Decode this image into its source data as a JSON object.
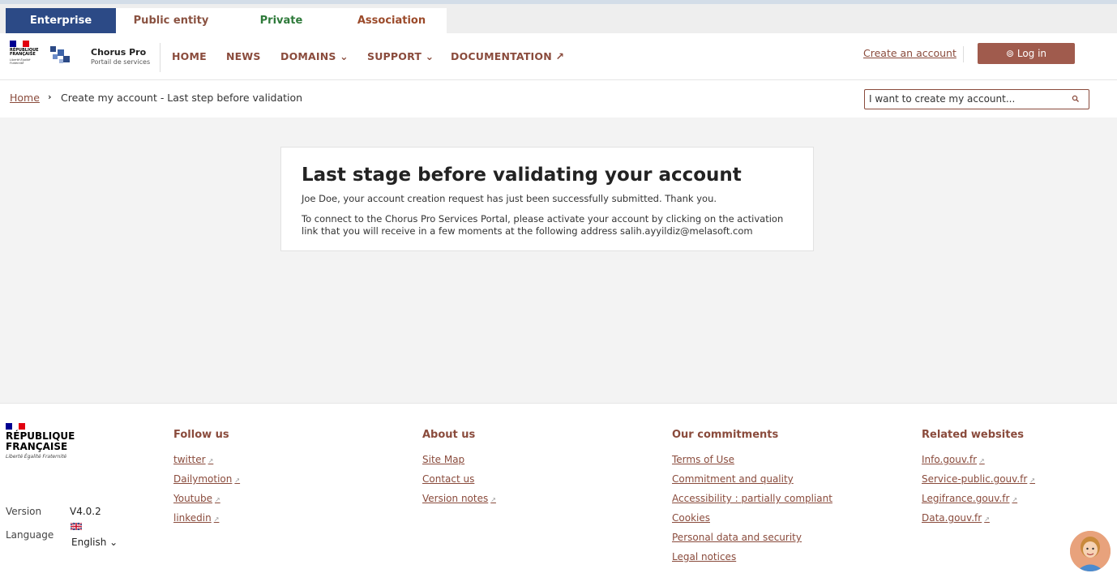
{
  "tabs": [
    {
      "label": "Enterprise"
    },
    {
      "label": "Public entity"
    },
    {
      "label": "Private"
    },
    {
      "label": "Association"
    }
  ],
  "header": {
    "rf_logo_text": "RÉPUBLIQUE FRANÇAISE",
    "rf_motto": "Liberté Égalité Fraternité",
    "brand_title": "Chorus Pro",
    "brand_subtitle": "Portail de services",
    "nav": [
      {
        "label": "HOME"
      },
      {
        "label": "NEWS"
      },
      {
        "label": "DOMAINS ⌄"
      },
      {
        "label": "SUPPORT ⌄"
      },
      {
        "label": "DOCUMENTATION ↗"
      }
    ],
    "create_account": "Create an account",
    "login": "⊚ Log in"
  },
  "breadcrumb": {
    "home": "Home",
    "separator": "›",
    "current": "Create my account - Last step before validation"
  },
  "search": {
    "value": "I want to create my account..."
  },
  "card": {
    "title": "Last stage before validating your account",
    "line1": "Joe Doe, your account creation request has just been successfully submitted. Thank you.",
    "line2": "To connect to the Chorus Pro Services Portal, please activate your account by clicking on the activation link that you will receive in a few moments at the following address salih.ayyildiz@melasoft.com"
  },
  "footer": {
    "rf_text_1": "RÉPUBLIQUE",
    "rf_text_2": "FRANÇAISE",
    "rf_motto": "Liberté Égalité Fraternité",
    "version_label": "Version",
    "version_value": "V4.0.2",
    "language_label": "Language",
    "language_value": "English ⌄",
    "columns": [
      {
        "title": "Follow us",
        "links": [
          "twitter",
          "Dailymotion",
          "Youtube",
          "linkedin"
        ]
      },
      {
        "title": "About us",
        "links": [
          "Site Map",
          "Contact us",
          "Version notes"
        ]
      },
      {
        "title": "Our commitments",
        "links": [
          "Terms of Use",
          "Commitment and quality",
          "Accessibility : partially compliant",
          "Cookies",
          "Personal data and security",
          "Legal notices"
        ]
      },
      {
        "title": "Related websites",
        "links": [
          "Info.gouv.fr",
          "Service-public.gouv.fr",
          "Legifrance.gouv.fr",
          "Data.gouv.fr"
        ]
      }
    ]
  },
  "colors": {
    "primary_blue": "#2c4a86",
    "brand_brown": "#8a4b3c",
    "login_bg": "#a05b4d",
    "flag_blue": "#000091",
    "flag_red": "#e1000f"
  }
}
